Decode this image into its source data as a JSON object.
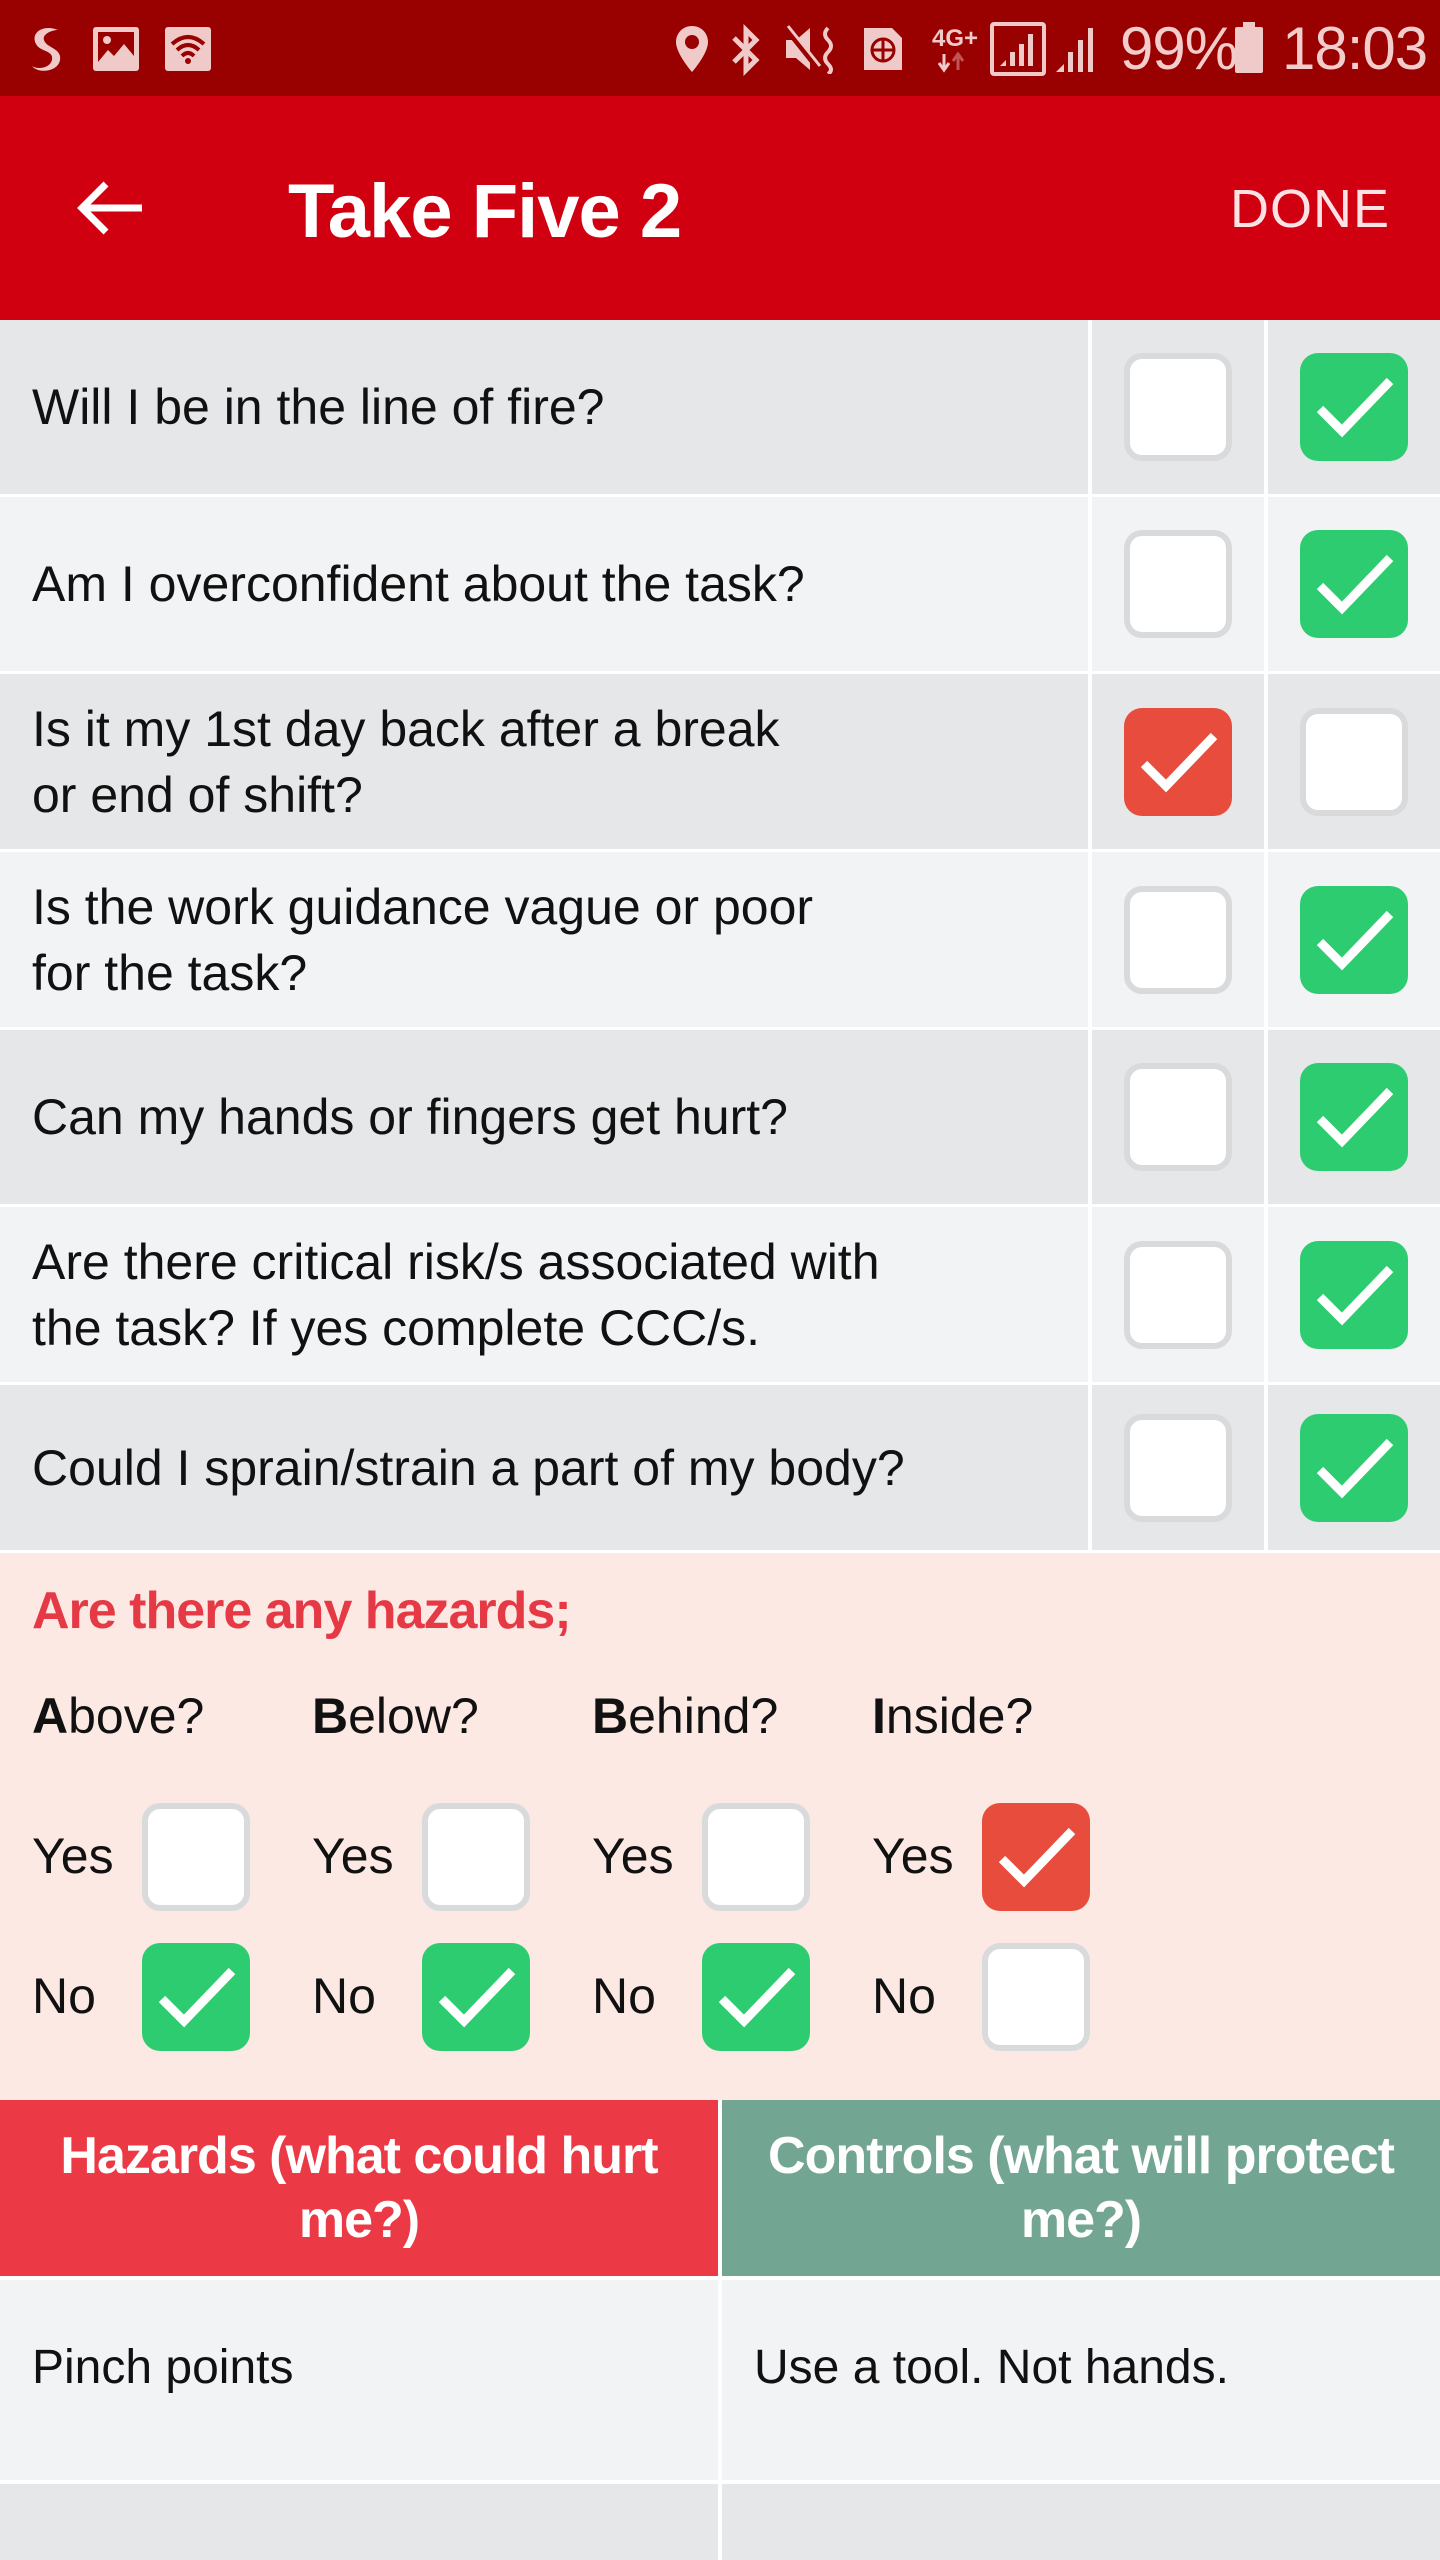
{
  "status_bar": {
    "left_icons": [
      "shazam-icon",
      "image-icon",
      "wifi-icon"
    ],
    "right_icons": [
      "location-icon",
      "bluetooth-icon",
      "mute-vibrate-icon",
      "sim-globe-icon",
      "network-4g-plus-icon",
      "signal-boxed-icon",
      "signal-icon",
      "battery-icon"
    ],
    "network_label": "4G+",
    "battery_percent": "99%",
    "time": "18:03"
  },
  "app_bar": {
    "back_icon": "arrow-left-icon",
    "title": "Take Five 2",
    "done_label": "DONE",
    "color": "#d10011"
  },
  "questions": [
    {
      "text": "Will I be in the line of fire?",
      "col1_checked": false,
      "col2_checked": true
    },
    {
      "text": "Am I overconfident about the task?",
      "col1_checked": false,
      "col2_checked": true
    },
    {
      "text": "Is it my 1st day back after a break\nor end of shift?",
      "col1_checked": true,
      "col2_checked": false
    },
    {
      "text": "Is the work guidance vague or poor\nfor the task?",
      "col1_checked": false,
      "col2_checked": true
    },
    {
      "text": "Can my hands or fingers get hurt?",
      "col1_checked": false,
      "col2_checked": true
    },
    {
      "text": "Are there critical risk/s associated with\nthe task? If yes complete CCC/s.",
      "col1_checked": false,
      "col2_checked": true
    },
    {
      "text": "Could I sprain/strain a part of my body?",
      "col1_checked": false,
      "col2_checked": true
    }
  ],
  "hazards": {
    "title": "Are there any hazards;",
    "yes_label": "Yes",
    "no_label": "No",
    "directions": [
      {
        "initial": "A",
        "rest": "bove?",
        "yes": false,
        "no": true
      },
      {
        "initial": "B",
        "rest": "elow?",
        "yes": false,
        "no": true
      },
      {
        "initial": "B",
        "rest": "ehind?",
        "yes": false,
        "no": true
      },
      {
        "initial": "I",
        "rest": "nside?",
        "yes": true,
        "no": false
      }
    ]
  },
  "controls_table": {
    "headers": {
      "hazards": "Hazards (what could hurt me?)",
      "controls": "Controls (what will protect me?)"
    },
    "rows": [
      {
        "hazard": "Pinch points",
        "control": "Use a tool. Not hands."
      },
      {
        "hazard": "",
        "control": ""
      }
    ]
  },
  "colors": {
    "status_bar": "#990000",
    "app_bar": "#d10011",
    "check_green": "#2ecc71",
    "check_red": "#e74c3c",
    "hazard_header": "#eb3a45",
    "control_header": "#72a592",
    "hazards_bg": "#fde9e4",
    "hazards_title": "#e63946"
  }
}
